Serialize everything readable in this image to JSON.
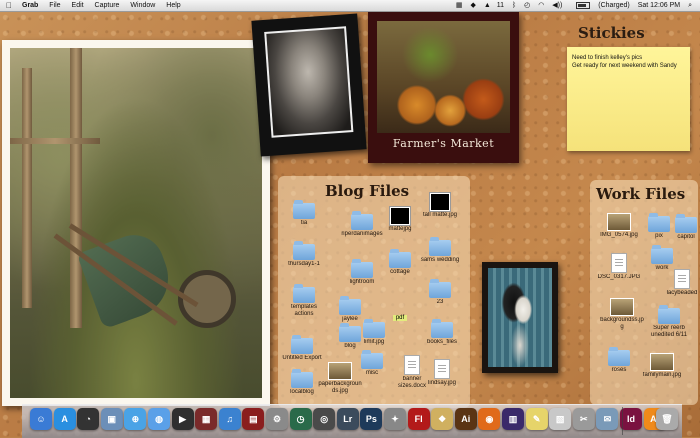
{
  "menubar": {
    "apple": "",
    "app_name": "Grab",
    "menus": [
      "File",
      "Edit",
      "Capture",
      "Window",
      "Help"
    ],
    "status": {
      "wifi_count": "11",
      "battery": "(Charged)",
      "clock": "Sat 12:06 PM"
    }
  },
  "photos": {
    "market_label": "Farmer's Market"
  },
  "stickies": {
    "title": "Stickies",
    "note_lines": [
      "Need to finish kelley's pics",
      "Get ready for next weekend with Sandy"
    ]
  },
  "blog_files": {
    "title": "Blog Files",
    "items": [
      {
        "label": "tia",
        "kind": "folder"
      },
      {
        "label": "riperdanimages",
        "kind": "folder"
      },
      {
        "label": "mattejpg",
        "kind": "black"
      },
      {
        "label": "tall matte.jpg",
        "kind": "black"
      },
      {
        "label": "thursday1-1",
        "kind": "folder"
      },
      {
        "label": "lightroom",
        "kind": "folder"
      },
      {
        "label": "cottage",
        "kind": "folder"
      },
      {
        "label": "sams wedding",
        "kind": "folder"
      },
      {
        "label": "templates actions",
        "kind": "folder"
      },
      {
        "label": "jaylee",
        "kind": "folder"
      },
      {
        "label": "pdf",
        "kind": "pdf"
      },
      {
        "label": "23",
        "kind": "folder"
      },
      {
        "label": "limit.jpg",
        "kind": "folder"
      },
      {
        "label": "blog",
        "kind": "folder"
      },
      {
        "label": "books_files",
        "kind": "folder"
      },
      {
        "label": "Untitled Export",
        "kind": "folder"
      },
      {
        "label": "localblog",
        "kind": "folder"
      },
      {
        "label": "paperbackgrounds.jpg",
        "kind": "photo"
      },
      {
        "label": "misc",
        "kind": "folder"
      },
      {
        "label": "banner sizes.docx",
        "kind": "doc"
      },
      {
        "label": "lindsay.jpg",
        "kind": "doc"
      }
    ]
  },
  "work_files": {
    "title": "Work Files",
    "items": [
      {
        "label": "IMG_0574.jpg",
        "kind": "photo"
      },
      {
        "label": "pix",
        "kind": "folder"
      },
      {
        "label": "capitol",
        "kind": "folder"
      },
      {
        "label": "DSC_0317.JPG",
        "kind": "doc"
      },
      {
        "label": "work",
        "kind": "folder"
      },
      {
        "label": "lacybeaded",
        "kind": "doc"
      },
      {
        "label": "backgroundss.jpg",
        "kind": "photo"
      },
      {
        "label": "Super reerb unedited 6/11",
        "kind": "folder"
      },
      {
        "label": "roses",
        "kind": "folder"
      },
      {
        "label": "familymain.jpg",
        "kind": "photo"
      }
    ]
  },
  "dock": {
    "items": [
      {
        "name": "finder",
        "glyph": "☺",
        "color": "#3a7bd5"
      },
      {
        "name": "app-store",
        "glyph": "A",
        "color": "#2a8fe0"
      },
      {
        "name": "dashboard",
        "glyph": "◔",
        "color": "#333333"
      },
      {
        "name": "preview",
        "glyph": "▣",
        "color": "#6c8fb8"
      },
      {
        "name": "safari",
        "glyph": "⊕",
        "color": "#4aa3e6"
      },
      {
        "name": "ichat",
        "glyph": "◍",
        "color": "#5aa0e8"
      },
      {
        "name": "facetime",
        "glyph": "▶",
        "color": "#2f2f2f"
      },
      {
        "name": "photo-booth",
        "glyph": "▦",
        "color": "#7a2a2a"
      },
      {
        "name": "itunes",
        "glyph": "♫",
        "color": "#3b82d0"
      },
      {
        "name": "preview-dark",
        "glyph": "▤",
        "color": "#8a1e1e"
      },
      {
        "name": "system-preferences",
        "glyph": "⚙",
        "color": "#8a8a8a"
      },
      {
        "name": "time-machine",
        "glyph": "◷",
        "color": "#2a6a4a"
      },
      {
        "name": "ios",
        "glyph": "◎",
        "color": "#4a4a4a"
      },
      {
        "name": "lightroom",
        "glyph": "Lr",
        "color": "#3b4b5c"
      },
      {
        "name": "photoshop",
        "glyph": "Ps",
        "color": "#1e3a5a"
      },
      {
        "name": "rocket",
        "glyph": "✦",
        "color": "#888888"
      },
      {
        "name": "flash",
        "glyph": "Fl",
        "color": "#b31a1a"
      },
      {
        "name": "color-sync",
        "glyph": "❖",
        "color": "#d0b060"
      },
      {
        "name": "illustrator",
        "glyph": "Ai",
        "color": "#5a3414"
      },
      {
        "name": "firefox",
        "glyph": "◉",
        "color": "#e06a1a"
      },
      {
        "name": "app-purple",
        "glyph": "▥",
        "color": "#3a2a6a"
      },
      {
        "name": "stickies",
        "glyph": "✎",
        "color": "#e6d46a"
      },
      {
        "name": "preview-stack",
        "glyph": "▧",
        "color": "#c8c8c8"
      },
      {
        "name": "grab",
        "glyph": "✂",
        "color": "#9a9a9a"
      },
      {
        "name": "mail",
        "glyph": "✉",
        "color": "#7a9ab8"
      },
      {
        "name": "indesign",
        "glyph": "Id",
        "color": "#7a1240"
      },
      {
        "name": "illustrator-2",
        "glyph": "Ai",
        "color": "#f08a1a"
      },
      {
        "name": "trash",
        "glyph": "🗑",
        "color": "#aaaaaa"
      }
    ]
  }
}
